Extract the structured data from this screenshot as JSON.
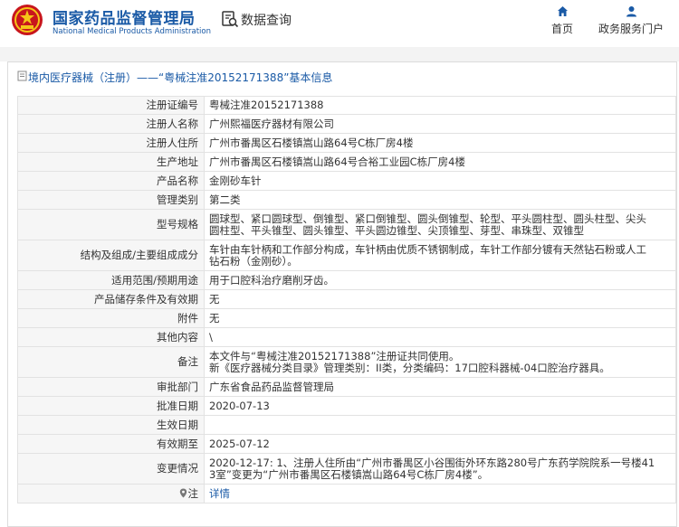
{
  "header": {
    "logo_cn": "国家药品监督管理局",
    "logo_en": "National Medical Products Administration",
    "query_label": "数据查询",
    "nav": [
      {
        "label": "首页",
        "icon": "home-icon"
      },
      {
        "label": "政务服务门户",
        "icon": "user-icon"
      }
    ]
  },
  "title_bar": {
    "text": "境内医疗器械（注册）——“粤械注准20152171388”基本信息"
  },
  "colors": {
    "brand_blue": "#1a5aa6",
    "emblem_red": "#c8161d",
    "emblem_gold": "#f5c518"
  },
  "fields": [
    {
      "key": "注册证编号",
      "lines": [
        "粤械注准20152171388"
      ]
    },
    {
      "key": "注册人名称",
      "lines": [
        "广州熙福医疗器材有限公司"
      ]
    },
    {
      "key": "注册人住所",
      "lines": [
        "广州市番禺区石楼镇嵩山路64号C栋厂房4楼"
      ]
    },
    {
      "key": "生产地址",
      "lines": [
        "广州市番禺区石楼镇嵩山路64号合裕工业园C栋厂房4楼"
      ]
    },
    {
      "key": "产品名称",
      "lines": [
        "金刚砂车针"
      ]
    },
    {
      "key": "管理类别",
      "lines": [
        "第二类"
      ]
    },
    {
      "key": "型号规格",
      "lines": [
        "圆球型、紧口圆球型、倒锥型、紧口倒锥型、圆头倒锥型、轮型、平头圆柱型、圆头柱型、尖头",
        "圆柱型、平头锥型、圆头锥型、平头圆边锥型、尖顶锥型、芽型、串珠型、双锥型"
      ]
    },
    {
      "key": "结构及组成/主要组成成分",
      "lines": [
        "车针由车针柄和工作部分构成，车针柄由优质不锈钢制成，车针工作部分镀有天然钻石粉或人工",
        "钻石粉（金刚砂）。"
      ]
    },
    {
      "key": "适用范围/预期用途",
      "lines": [
        "用于口腔科治疗磨削牙齿。"
      ]
    },
    {
      "key": "产品储存条件及有效期",
      "lines": [
        "无"
      ]
    },
    {
      "key": "附件",
      "lines": [
        "无"
      ]
    },
    {
      "key": "其他内容",
      "lines": [
        "\\"
      ]
    },
    {
      "key": "备注",
      "lines": [
        "本文件与“粤械注准20152171388”注册证共同使用。",
        "新《医疗器械分类目录》管理类别：II类，分类编码：17口腔科器械-04口腔治疗器具。"
      ]
    },
    {
      "key": "审批部门",
      "lines": [
        "广东省食品药品监督管理局"
      ]
    },
    {
      "key": "批准日期",
      "lines": [
        "2020-07-13"
      ]
    },
    {
      "key": "生效日期",
      "lines": [
        ""
      ]
    },
    {
      "key": "有效期至",
      "lines": [
        "2025-07-12"
      ]
    },
    {
      "key": "变更情况",
      "lines": [
        "2020-12-17: 1、注册人住所由“广州市番禺区小谷围街外环东路280号广东药学院院系一号楼41",
        "3室”变更为“广州市番禺区石楼镇嵩山路64号C栋厂房4楼”。"
      ]
    }
  ],
  "note": {
    "key": "注",
    "icon": "location-pin-icon",
    "link": "详情"
  }
}
